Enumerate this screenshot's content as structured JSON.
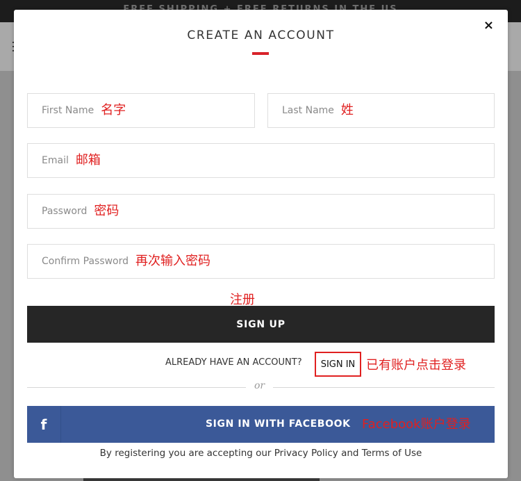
{
  "background": {
    "topbar_text": "FREE SHIPPING + FREE RETURNS IN THE US"
  },
  "modal": {
    "close_label": "×",
    "title": "CREATE AN ACCOUNT",
    "accent_color": "#d8232a",
    "fields": {
      "first_name": {
        "placeholder": "First Name",
        "annotation": "名字"
      },
      "last_name": {
        "placeholder": "Last Name",
        "annotation": "姓"
      },
      "email": {
        "placeholder": "Email",
        "annotation": "邮箱"
      },
      "password": {
        "placeholder": "Password",
        "annotation": "密码"
      },
      "confirm_password": {
        "placeholder": "Confirm Password",
        "annotation": "再次输入密码"
      }
    },
    "signup": {
      "annotation": "注册",
      "label": "SIGN UP",
      "color": "#262626"
    },
    "already": {
      "text": "ALREADY HAVE AN ACCOUNT?",
      "signin_label": "SIGN IN",
      "annotation": "已有账户点击登录"
    },
    "divider_text": "or",
    "facebook": {
      "icon": "f",
      "label": "SIGN IN WITH FACEBOOK",
      "annotation": "Facebook账户登录",
      "color": "#3b5998"
    },
    "terms": "By registering you are accepting our Privacy Policy and Terms of Use"
  }
}
